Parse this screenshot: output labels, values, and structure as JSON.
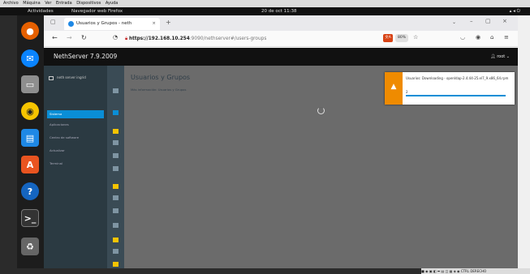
{
  "vm_menu": [
    "Archivo",
    "Máquina",
    "Ver",
    "Entrada",
    "Dispositivos",
    "Ayuda"
  ],
  "topbar": {
    "activities": "Actividades",
    "app_name": "Navegador web Firefox",
    "clock": "20 de oct 11:38",
    "system_icons": "network-volume-power"
  },
  "dock_icons": [
    "firefox-icon",
    "thunderbird-icon",
    "files-icon",
    "rhythmbox-icon",
    "libreoffice-writer-icon",
    "app-center-icon",
    "help-icon",
    "terminal-icon",
    "trash-icon"
  ],
  "browser": {
    "tab_title": "Usuarios y Grupos - neth",
    "url_host": "https://192.168.10.254",
    "url_rest": ":9090/nethserver#/users-groups",
    "zoom": "80%"
  },
  "nethserver": {
    "title": "NethServer 7.9.2009",
    "user": "root",
    "host_label": "neth server ingrid",
    "nav": [
      "Sistema",
      "Aplicaciones",
      "Centro de software",
      "Actualizar",
      "Terminal"
    ],
    "active_nav": "Sistema",
    "page_title": "Usuarios y Grupos",
    "subtitle": "Más información: Usuarios y Grupos"
  },
  "notification": {
    "icon": "warning-icon",
    "text": "Usuarios: Downloading - openldap-2.4.44-25.el7_9.x86_64.rpm",
    "percent": "2",
    "progress": 1.0,
    "color": "#ef8b00"
  },
  "colors": {
    "accent": "#0a8ed6",
    "warning": "#ef8b00"
  },
  "statusbar": {
    "tray_text": "CTRL DERECHO"
  }
}
